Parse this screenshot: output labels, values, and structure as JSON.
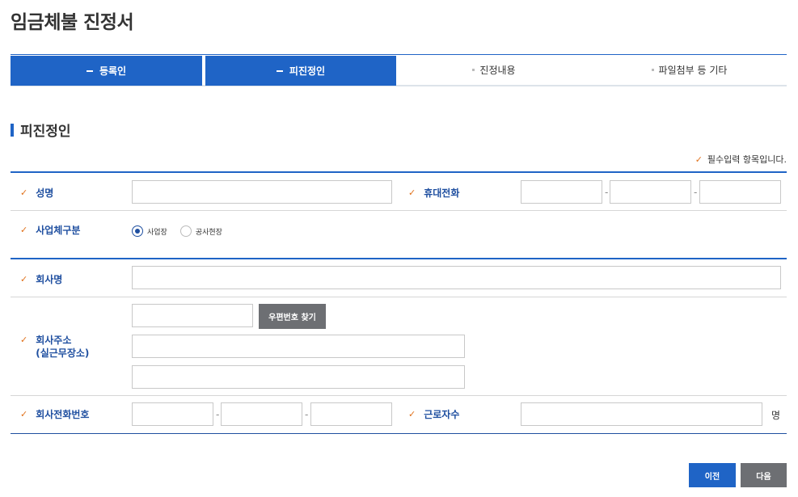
{
  "page": {
    "title": "임금체불 진정서"
  },
  "steps": [
    {
      "label": "등록인",
      "active": true
    },
    {
      "label": "피진정인",
      "active": true
    },
    {
      "label": "진정내용",
      "active": false
    },
    {
      "label": "파일첨부 등 기타",
      "active": false
    }
  ],
  "section": {
    "title": "피진정인"
  },
  "required_note": "필수입력 항목입니다.",
  "fields": {
    "name": {
      "label": "성명",
      "value": ""
    },
    "mobile": {
      "label": "휴대전화",
      "sep": "-"
    },
    "business_type": {
      "label": "사업체구분",
      "options": [
        "사업장",
        "공사현장"
      ],
      "selected": "사업장"
    },
    "company_name": {
      "label": "회사명",
      "value": ""
    },
    "company_address": {
      "label_line1": "회사주소",
      "label_line2": "(실근무장소)",
      "zip_button": "우편번호 찾기"
    },
    "company_phone": {
      "label": "회사전화번호",
      "sep": "-"
    },
    "workers": {
      "label": "근로자수",
      "unit": "명"
    }
  },
  "buttons": {
    "prev": "이전",
    "next": "다음"
  },
  "colors": {
    "primary": "#1f64c6",
    "label": "#1f4fa0",
    "check": "#e0701a",
    "gray_button": "#6d6f73"
  }
}
